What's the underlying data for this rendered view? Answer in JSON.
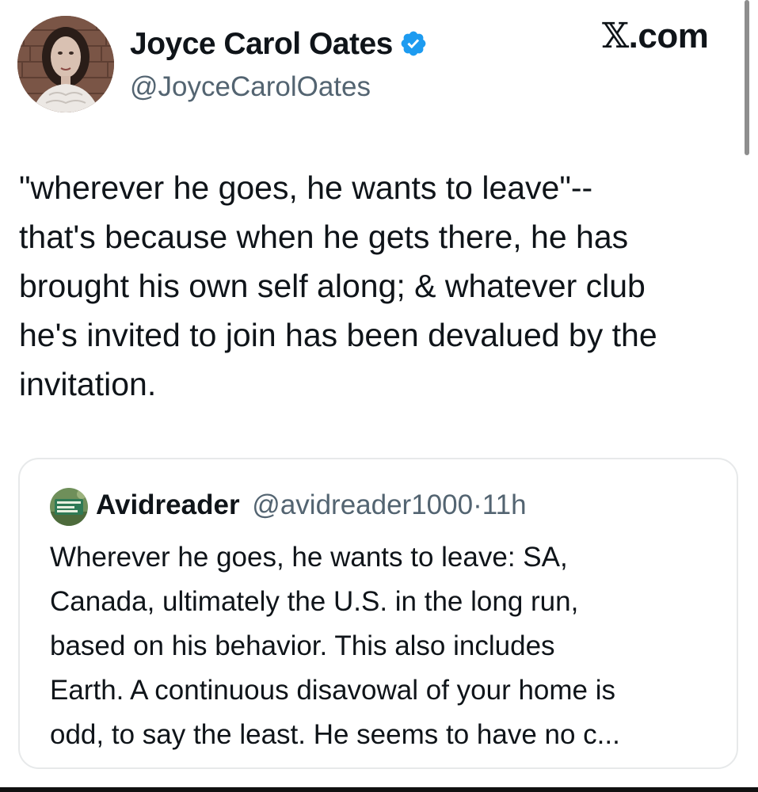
{
  "brand": {
    "site_label": ".com",
    "x_glyph": "𝕏"
  },
  "tweet": {
    "author_name": "Joyce Carol Oates",
    "author_handle": "@JoyceCarolOates",
    "verified": true,
    "text": "\"wherever he goes, he wants to leave\"--\nthat's because when he gets there, he has\nbrought his own self along; & whatever club\nhe's invited to join has been devalued by the\ninvitation."
  },
  "quoted_tweet": {
    "author_name": "Avidreader",
    "author_handle": "@avidreader1000",
    "separator": "·",
    "time": "11h",
    "text": "Wherever he goes, he wants to leave: SA,\nCanada, ultimately the U.S. in the long run,\nbased on his behavior. This also includes\nEarth. A continuous disavowal of your home is\nodd, to say the least. He seems to have no c..."
  },
  "colors": {
    "text_primary": "#0f1419",
    "text_secondary": "#536471",
    "verified_blue": "#1d9bf0",
    "card_border": "#e7e9ea"
  },
  "icons": {
    "verified": "verified-badge-icon",
    "avatar": "profile-photo",
    "quote_avatar": "profile-photo"
  }
}
